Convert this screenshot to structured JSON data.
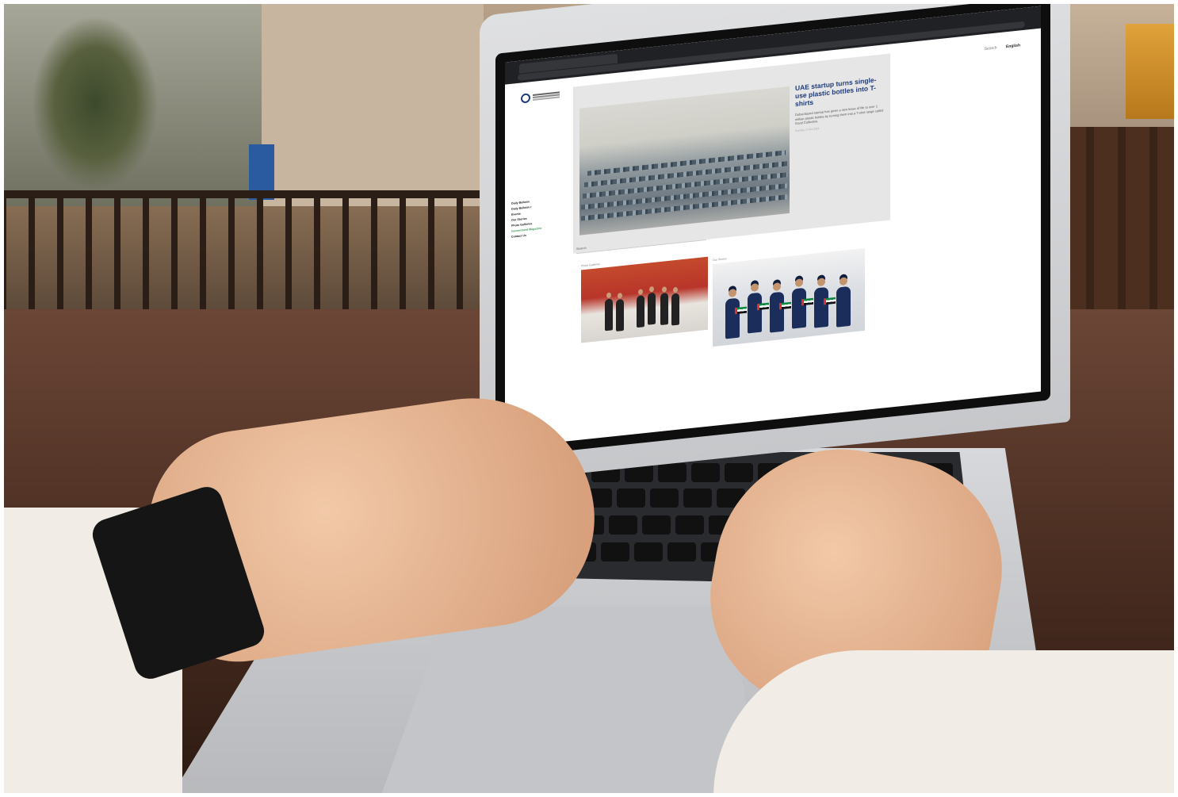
{
  "site": {
    "top_links": [
      "Search",
      "English"
    ]
  },
  "side_nav": {
    "items": [
      "Daily Bulletin",
      "Daily Bulletin +",
      "Events",
      "Our Stories",
      "Photo Galleries",
      "Government Magazine",
      "Contact Us"
    ],
    "active_index": 5
  },
  "hero": {
    "title": "UAE startup turns single-use plastic bottles into T-shirts",
    "body": "Dubai-based startup has given a new lease of life to over 1 million plastic bottles by turning them into a T-shirt range called Good Collective.",
    "date": "Sunday, 3 Oct 2021"
  },
  "search": {
    "label": "Search"
  },
  "cards": [
    {
      "label": "Photo Galleries"
    },
    {
      "label": "Our Stories"
    }
  ],
  "colors": {
    "brand_navy": "#1f3b7a",
    "active_green": "#3a9a55",
    "uae_green": "#0a8a3e",
    "uae_red": "#e03030"
  }
}
